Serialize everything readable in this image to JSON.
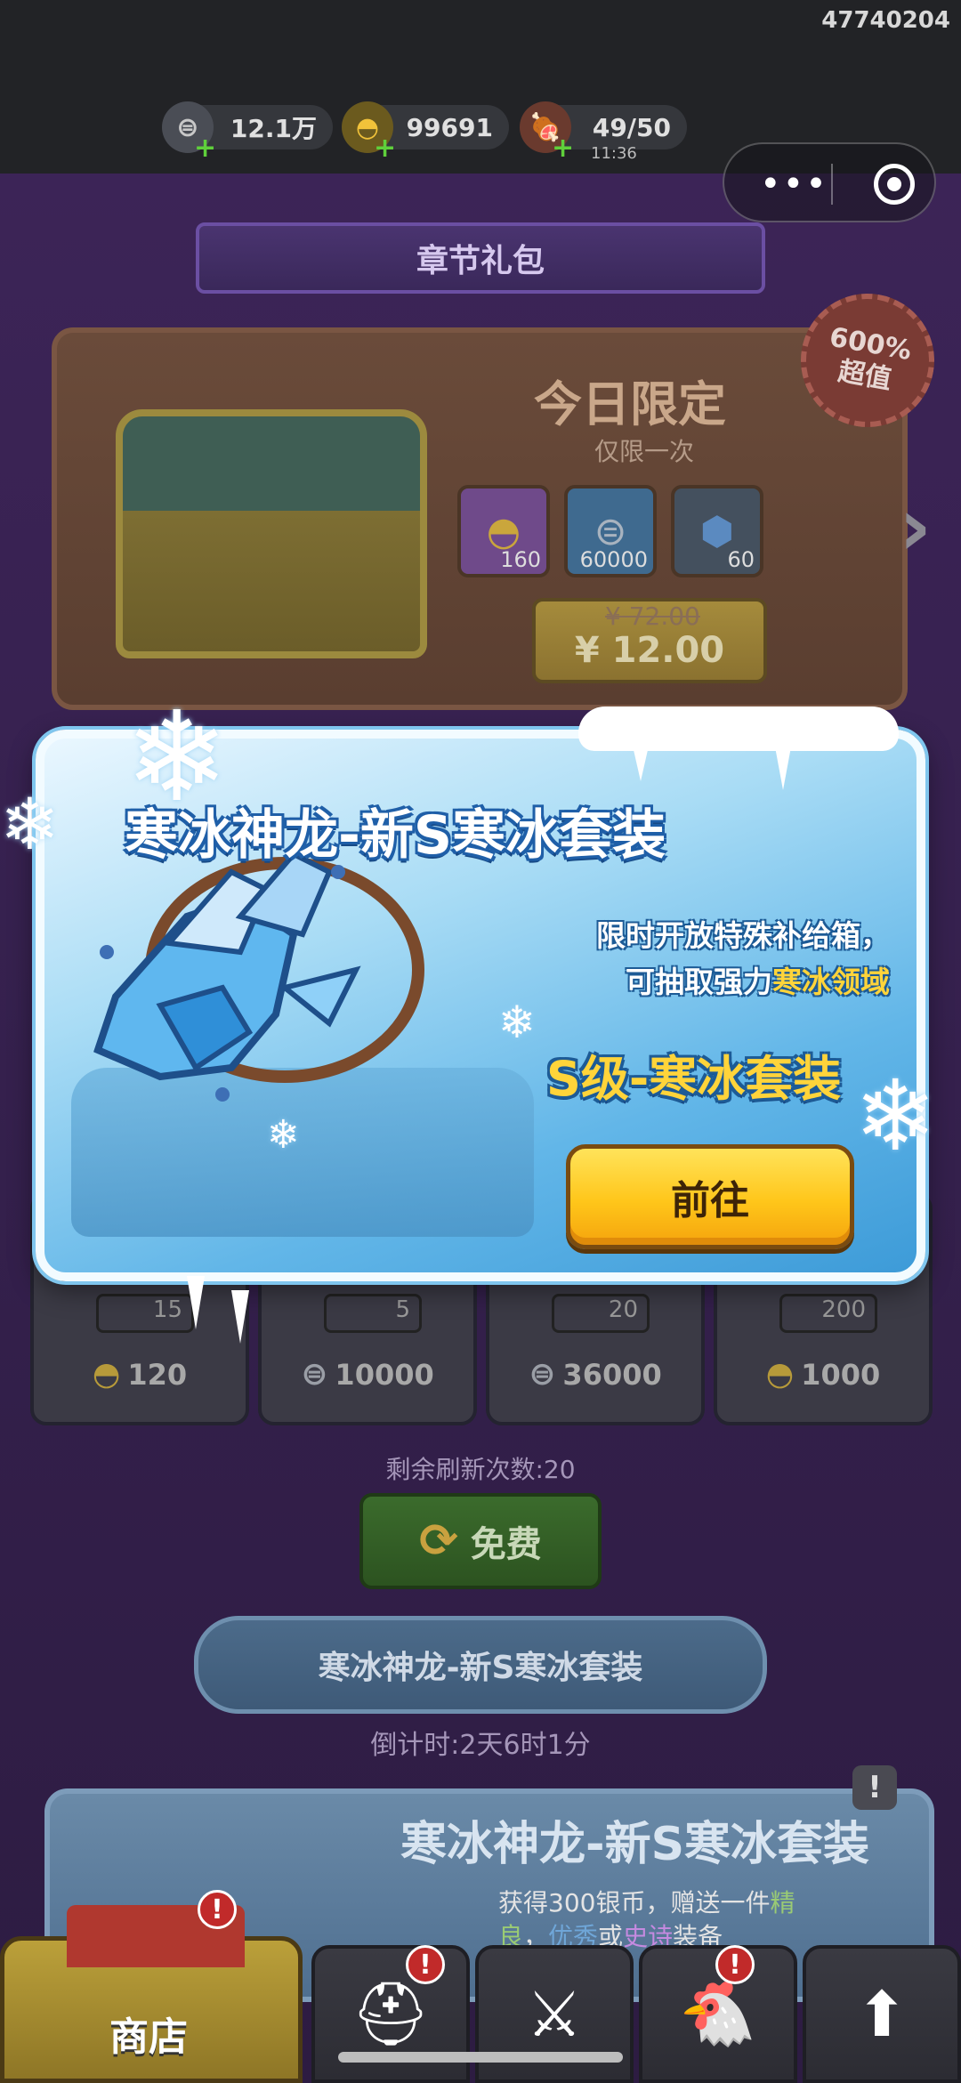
{
  "status": {
    "player_id": "47740204"
  },
  "resources": [
    {
      "name": "silver",
      "icon": "silver-coin-icon",
      "value": "12.1万"
    },
    {
      "name": "gold",
      "icon": "gold-ingot-icon",
      "value": "99691"
    },
    {
      "name": "stamina",
      "icon": "meat-icon",
      "value": "49/50",
      "timer": "11:36"
    }
  ],
  "chapter_pack": {
    "banner": "章节礼包",
    "badge_line1": "600%",
    "badge_line2": "超值",
    "title": "今日限定",
    "subtitle": "仅限一次",
    "rewards": [
      {
        "icon": "gold-ingot-icon",
        "qty": "160",
        "color": "#6f4a8a"
      },
      {
        "icon": "silver-coin-icon",
        "qty": "60000",
        "color": "#3f6a8f"
      },
      {
        "icon": "blue-gem-icon",
        "qty": "60",
        "color": "#44505e"
      }
    ],
    "old_price": "¥ 72.00",
    "price": "¥ 12.00"
  },
  "shop_grid": [
    {
      "count": "15",
      "price": "120",
      "currency": "gold-ingot-icon"
    },
    {
      "count": "5",
      "price": "10000",
      "currency": "silver-coin-icon"
    },
    {
      "count": "20",
      "price": "36000",
      "currency": "silver-coin-icon"
    },
    {
      "count": "200",
      "price": "1000",
      "currency": "gold-ingot-icon"
    }
  ],
  "refresh": {
    "remaining": "剩余刷新次数:20",
    "button": "免费"
  },
  "event": {
    "banner": "寒冰神龙-新S寒冰套装",
    "countdown": "倒计时:2天6时1分",
    "card_title": "寒冰神龙-新S寒冰套装",
    "card_desc_1": "获得300银币，赠送一件",
    "card_desc_green": "精良",
    "card_desc_comma": "，",
    "card_desc_blue": "优秀",
    "card_desc_or": "或",
    "card_desc_purple": "史诗",
    "card_desc_end": "装备"
  },
  "nav": {
    "shop_label": "商店"
  },
  "popup": {
    "title": "寒冰神龙-新S寒冰套装",
    "desc_line1": "限时开放特殊补给箱，",
    "desc_line2_prefix": "可抽取强力",
    "desc_line2_highlight": "寒冰领域",
    "grade": "S级-寒冰套装",
    "button": "前往"
  }
}
